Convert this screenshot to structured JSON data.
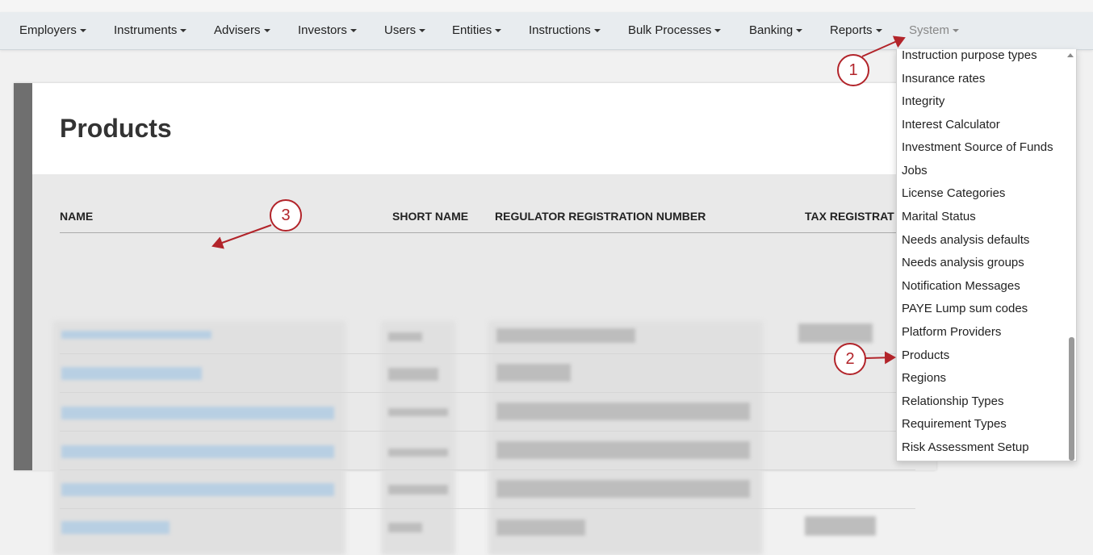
{
  "navbar": {
    "items": [
      {
        "label": "Employers"
      },
      {
        "label": "Instruments"
      },
      {
        "label": "Advisers"
      },
      {
        "label": "Investors"
      },
      {
        "label": "Users"
      },
      {
        "label": "Entities"
      },
      {
        "label": "Instructions"
      },
      {
        "label": "Bulk Processes"
      },
      {
        "label": "Banking"
      },
      {
        "label": "Reports"
      },
      {
        "label": "System"
      }
    ]
  },
  "page": {
    "title": "Products"
  },
  "table": {
    "columns": [
      {
        "label": "NAME"
      },
      {
        "label": "SHORT NAME"
      },
      {
        "label": "REGULATOR REGISTRATION NUMBER"
      },
      {
        "label": "TAX REGISTRAT"
      }
    ]
  },
  "system_menu": {
    "items": [
      {
        "label": "Instruction purpose types"
      },
      {
        "label": "Insurance rates"
      },
      {
        "label": "Integrity"
      },
      {
        "label": "Interest Calculator"
      },
      {
        "label": "Investment Source of Funds"
      },
      {
        "label": "Jobs"
      },
      {
        "label": "License Categories"
      },
      {
        "label": "Marital Status"
      },
      {
        "label": "Needs analysis defaults"
      },
      {
        "label": "Needs analysis groups"
      },
      {
        "label": "Notification Messages"
      },
      {
        "label": "PAYE Lump sum codes"
      },
      {
        "label": "Platform Providers"
      },
      {
        "label": "Products"
      },
      {
        "label": "Regions"
      },
      {
        "label": "Relationship Types"
      },
      {
        "label": "Requirement Types"
      },
      {
        "label": "Risk Assessment Setup"
      }
    ]
  },
  "annotations": {
    "callouts": [
      {
        "label": "1"
      },
      {
        "label": "2"
      },
      {
        "label": "3"
      }
    ],
    "color": "#b2242a"
  }
}
